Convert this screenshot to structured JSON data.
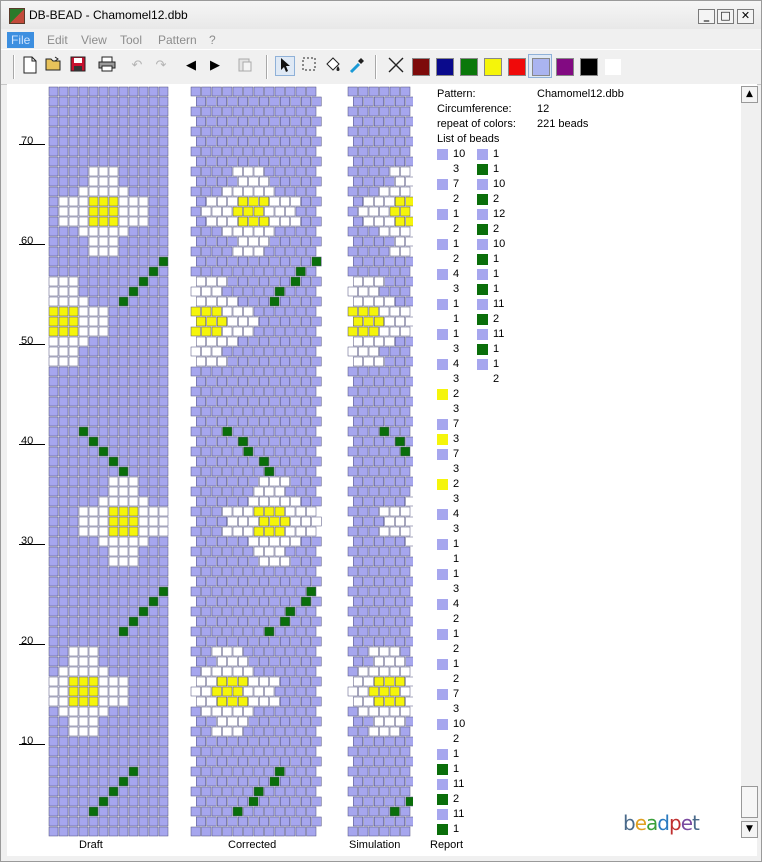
{
  "window": {
    "title": "DB-BEAD - Chamomel12.dbb",
    "controls": {
      "minimize": "_",
      "maximize": "□",
      "close": "✕"
    }
  },
  "menu": [
    "File",
    "Edit",
    "View",
    "Tool",
    "Pattern",
    "?"
  ],
  "toolbar": {
    "icons": [
      "new-file-icon",
      "open-folder-icon",
      "save-icon",
      "print-icon",
      "undo-icon",
      "redo-icon",
      "arrow-left-icon",
      "arrow-right-icon",
      "paste-icon",
      "pointer-icon",
      "select-rect-icon",
      "fill-icon",
      "eyedropper-icon",
      "eraser-icon"
    ],
    "palette": [
      "#7d0a0a",
      "#0a0a8c",
      "#0a780a",
      "#f5f50a",
      "#f00a0a",
      "#aab4f0",
      "#820a82",
      "#000000",
      "#ffffff"
    ],
    "selected_color": "#aab4f0"
  },
  "colors": {
    "lavender": "#a6a6ee",
    "white": "#ffffff",
    "green": "#0a6e0a",
    "yellow": "#f5f50a",
    "gridline": "#4d4d7a"
  },
  "ruler": {
    "labels": [
      "70",
      "60",
      "50",
      "40",
      "30",
      "20",
      "10"
    ]
  },
  "views": {
    "draft": "Draft",
    "corrected": "Corrected",
    "simulation": "Simulation",
    "report": "Report"
  },
  "report": {
    "pattern_label": "Pattern:",
    "pattern_value": "Chamomel12.dbb",
    "circ_label": "Circumference:",
    "circ_value": "12",
    "repeat_label": "repeat of colors:",
    "repeat_value": "221 beads",
    "list_label": "List of beads",
    "col1": [
      {
        "c": "lav",
        "n": "10"
      },
      {
        "c": "wht",
        "n": "3"
      },
      {
        "c": "lav",
        "n": "7"
      },
      {
        "c": "wht",
        "n": "2"
      },
      {
        "c": "lav",
        "n": "1"
      },
      {
        "c": "wht",
        "n": "2"
      },
      {
        "c": "lav",
        "n": "1"
      },
      {
        "c": "wht",
        "n": "2"
      },
      {
        "c": "lav",
        "n": "4"
      },
      {
        "c": "wht",
        "n": "3"
      },
      {
        "c": "lav",
        "n": "1"
      },
      {
        "c": "wht",
        "n": "1"
      },
      {
        "c": "lav",
        "n": "1"
      },
      {
        "c": "wht",
        "n": "3"
      },
      {
        "c": "lav",
        "n": "4"
      },
      {
        "c": "wht",
        "n": "3"
      },
      {
        "c": "yel",
        "n": "2"
      },
      {
        "c": "wht",
        "n": "3"
      },
      {
        "c": "lav",
        "n": "7"
      },
      {
        "c": "yel",
        "n": "3"
      },
      {
        "c": "lav",
        "n": "7"
      },
      {
        "c": "wht",
        "n": "3"
      },
      {
        "c": "yel",
        "n": "2"
      },
      {
        "c": "wht",
        "n": "3"
      },
      {
        "c": "lav",
        "n": "4"
      },
      {
        "c": "wht",
        "n": "3"
      },
      {
        "c": "lav",
        "n": "1"
      },
      {
        "c": "wht",
        "n": "1"
      },
      {
        "c": "lav",
        "n": "1"
      },
      {
        "c": "wht",
        "n": "3"
      },
      {
        "c": "lav",
        "n": "4"
      },
      {
        "c": "wht",
        "n": "2"
      },
      {
        "c": "lav",
        "n": "1"
      },
      {
        "c": "wht",
        "n": "2"
      },
      {
        "c": "lav",
        "n": "1"
      },
      {
        "c": "wht",
        "n": "2"
      },
      {
        "c": "lav",
        "n": "7"
      },
      {
        "c": "wht",
        "n": "3"
      },
      {
        "c": "lav",
        "n": "10"
      },
      {
        "c": "wht",
        "n": "2"
      },
      {
        "c": "lav",
        "n": "1"
      },
      {
        "c": "grn",
        "n": "1"
      },
      {
        "c": "lav",
        "n": "11"
      },
      {
        "c": "grn",
        "n": "2"
      },
      {
        "c": "lav",
        "n": "11"
      },
      {
        "c": "grn",
        "n": "1"
      }
    ],
    "col2": [
      {
        "c": "lav",
        "n": "1"
      },
      {
        "c": "grn",
        "n": "1"
      },
      {
        "c": "lav",
        "n": "10"
      },
      {
        "c": "grn",
        "n": "2"
      },
      {
        "c": "lav",
        "n": "12"
      },
      {
        "c": "grn",
        "n": "2"
      },
      {
        "c": "lav",
        "n": "10"
      },
      {
        "c": "grn",
        "n": "1"
      },
      {
        "c": "lav",
        "n": "1"
      },
      {
        "c": "grn",
        "n": "1"
      },
      {
        "c": "lav",
        "n": "11"
      },
      {
        "c": "grn",
        "n": "2"
      },
      {
        "c": "lav",
        "n": "11"
      },
      {
        "c": "grn",
        "n": "1"
      },
      {
        "c": "lav",
        "n": "1"
      },
      {
        "c": "wht",
        "n": "2"
      }
    ]
  }
}
